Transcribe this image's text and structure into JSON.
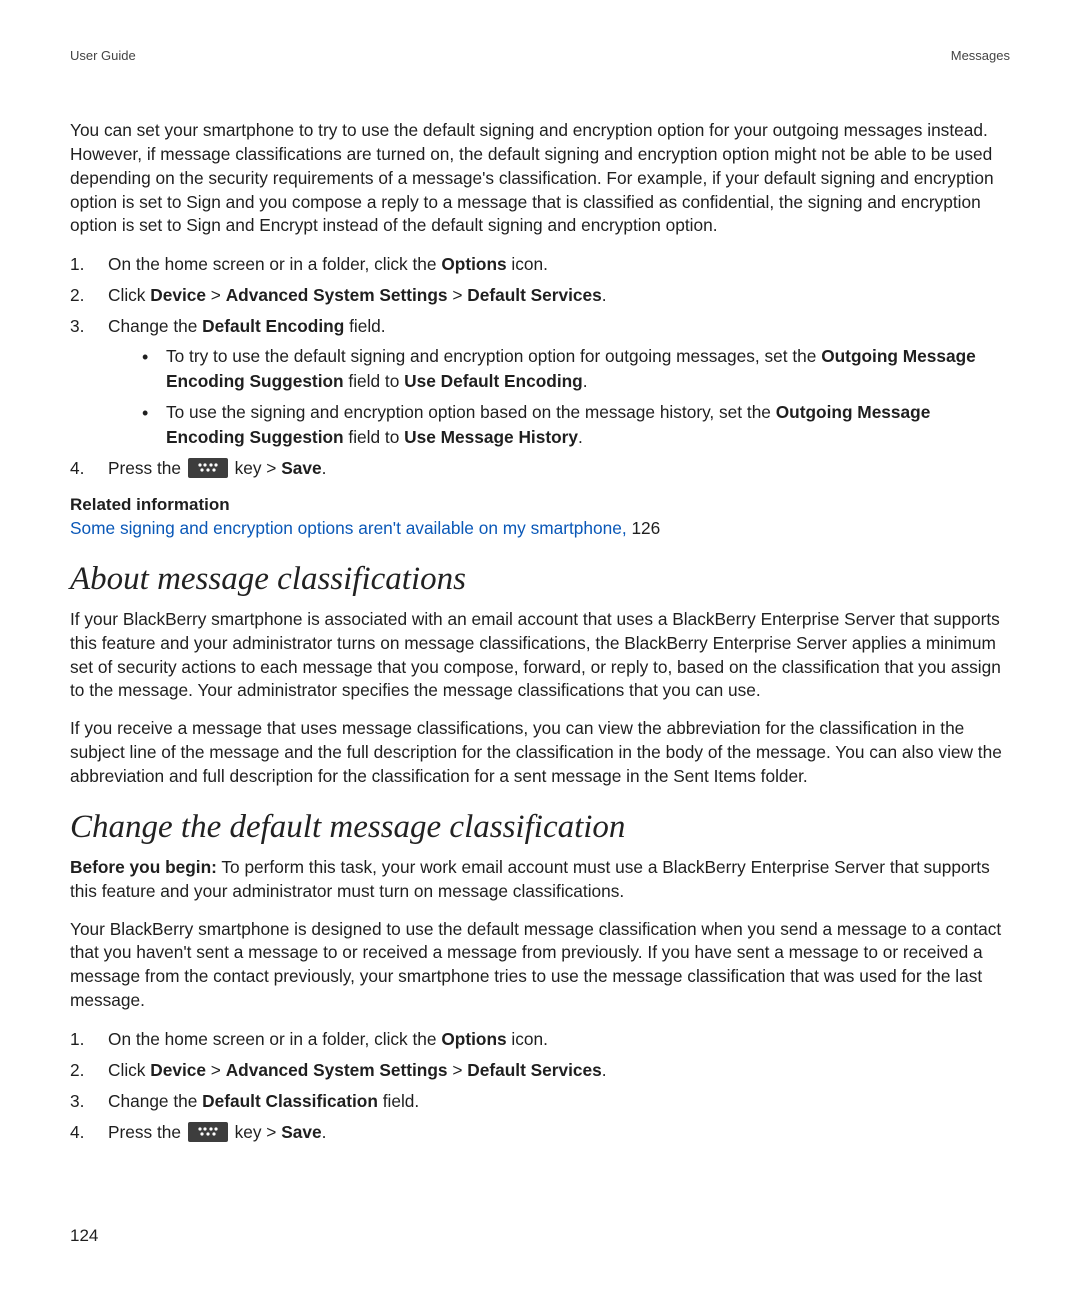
{
  "header": {
    "left": "User Guide",
    "right": "Messages"
  },
  "intro": "You can set your smartphone to try to use the default signing and encryption option for your outgoing messages instead. However, if message classifications are turned on, the default signing and encryption option might not be able to be used depending on the security requirements of a message's classification. For example, if your default signing and encryption option is set to Sign and you compose a reply to a message that is classified as confidential, the signing and encryption option is set to Sign and Encrypt instead of the default signing and encryption option.",
  "steps1": {
    "s1_a": "On the home screen or in a folder, click the ",
    "s1_b": "Options",
    "s1_c": " icon.",
    "s2_a": "Click ",
    "s2_b": "Device",
    "s2_c": " > ",
    "s2_d": "Advanced System Settings",
    "s2_e": " > ",
    "s2_f": "Default Services",
    "s2_g": ".",
    "s3_a": "Change the ",
    "s3_b": "Default Encoding",
    "s3_c": " field.",
    "b1_a": "To try to use the default signing and encryption option for outgoing messages, set the ",
    "b1_b": "Outgoing Message Encoding Suggestion",
    "b1_c": " field to ",
    "b1_d": "Use Default Encoding",
    "b1_e": ".",
    "b2_a": "To use the signing and encryption option based on the message history, set the ",
    "b2_b": "Outgoing Message Encoding Suggestion",
    "b2_c": " field to ",
    "b2_d": "Use Message History",
    "b2_e": ".",
    "s4_a": "Press the ",
    "s4_b": " key > ",
    "s4_c": "Save",
    "s4_d": "."
  },
  "related": {
    "heading": "Related information",
    "link": "Some signing and encryption options aren't available on my smartphone, ",
    "page": "126"
  },
  "section2": {
    "title": "About message classifications",
    "p1": "If your BlackBerry smartphone is associated with an email account that uses a BlackBerry Enterprise Server that supports this feature and your administrator turns on message classifications, the BlackBerry Enterprise Server applies a minimum set of security actions to each message that you compose, forward, or reply to, based on the classification that you assign to the message. Your administrator specifies the message classifications that you can use.",
    "p2": "If you receive a message that uses message classifications, you can view the abbreviation for the classification in the subject line of the message and the full description for the classification in the body of the message. You can also view the abbreviation and full description for the classification for a sent message in the Sent Items folder."
  },
  "section3": {
    "title": "Change the default message classification",
    "before_label": "Before you begin:",
    "before_text": " To perform this task, your work email account must use a BlackBerry Enterprise Server that supports this feature and your administrator must turn on message classifications.",
    "p2": "Your BlackBerry smartphone is designed to use the default message classification when you send a message to a contact that you haven't sent a message to or received a message from previously. If you have sent a message to or received a message from the contact previously, your smartphone tries to use the message classification that was used for the last message."
  },
  "steps2": {
    "s1_a": "On the home screen or in a folder, click the ",
    "s1_b": "Options",
    "s1_c": " icon.",
    "s2_a": "Click ",
    "s2_b": "Device",
    "s2_c": " > ",
    "s2_d": "Advanced System Settings",
    "s2_e": " > ",
    "s2_f": "Default Services",
    "s2_g": ".",
    "s3_a": "Change the ",
    "s3_b": "Default Classification",
    "s3_c": " field.",
    "s4_a": "Press the ",
    "s4_b": " key > ",
    "s4_c": "Save",
    "s4_d": "."
  },
  "page_number": "124"
}
